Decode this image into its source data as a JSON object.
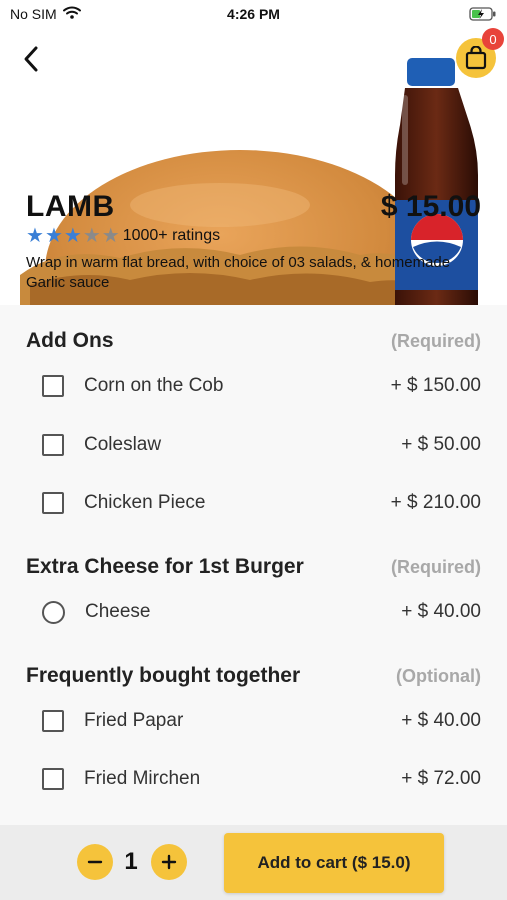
{
  "status_bar": {
    "carrier": "No SIM",
    "time": "4:26 PM"
  },
  "header": {
    "cart_count": "0"
  },
  "product": {
    "title": "LAMB",
    "price": "$ 15.00",
    "rating_stars": 3,
    "rating_max": 5,
    "ratings_text": "1000+ ratings",
    "description": "Wrap in warm flat bread, with choice of 03 salads, & homemade Garlic sauce"
  },
  "sections": [
    {
      "title": "Add Ons",
      "tag": "(Required)",
      "options": [
        {
          "label": "Corn on the Cob",
          "price": "+ $ 150.00",
          "control": "checkbox",
          "checked": false
        },
        {
          "label": "Coleslaw",
          "price": "+ $ 50.00",
          "control": "checkbox",
          "checked": false
        },
        {
          "label": "Chicken Piece",
          "price": "+ $ 210.00",
          "control": "checkbox",
          "checked": false
        }
      ]
    },
    {
      "title": "Extra Cheese for 1st Burger",
      "tag": "(Required)",
      "options": [
        {
          "label": "Cheese",
          "price": "+ $ 40.00",
          "control": "radio",
          "checked": false
        }
      ]
    },
    {
      "title": "Frequently bought together",
      "tag": "(Optional)",
      "options": [
        {
          "label": "Fried Papar",
          "price": "+ $ 40.00",
          "control": "checkbox",
          "checked": false
        },
        {
          "label": "Fried Mirchen",
          "price": "+ $ 72.00",
          "control": "checkbox",
          "checked": false
        }
      ]
    }
  ],
  "bottom_bar": {
    "quantity": "1",
    "add_to_cart_label": "Add to cart ($ 15.0)"
  },
  "colors": {
    "accent": "#f5c33b",
    "badge": "#e8433a",
    "star_filled": "#3a7fd6",
    "star_empty": "#8a8a8a",
    "tag_gray": "#a8a8a8"
  }
}
